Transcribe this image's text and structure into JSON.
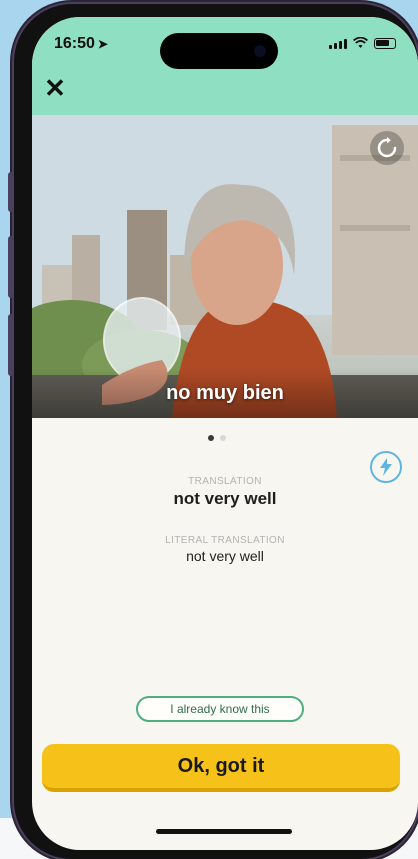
{
  "status_bar": {
    "time": "16:50"
  },
  "video": {
    "caption": "no muy bien"
  },
  "pagination": {
    "total": 2,
    "active_index": 0
  },
  "translation": {
    "label": "TRANSLATION",
    "value": "not very well",
    "literal_label": "LITERAL TRANSLATION",
    "literal_value": "not very well"
  },
  "buttons": {
    "know_label": "I already know this",
    "ok_label": "Ok, got it"
  },
  "colors": {
    "header_bg": "#8fe0c2",
    "primary_button": "#f6c21a",
    "outline_button": "#4caf7d",
    "boost_icon": "#5eb6e0"
  },
  "icons": [
    "close-icon",
    "replay-icon",
    "boost-icon",
    "location-arrow-icon",
    "wifi-icon",
    "battery-icon",
    "signal-icon"
  ]
}
